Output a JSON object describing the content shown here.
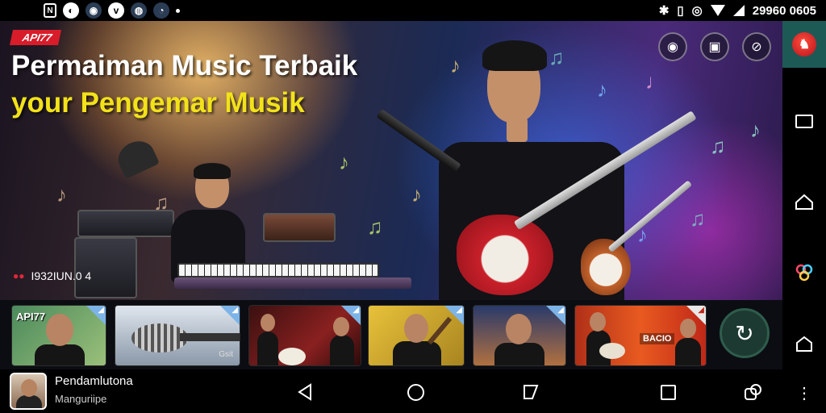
{
  "status_bar": {
    "left_icons": [
      "n-icon",
      "shield-icon",
      "avatar-icon",
      "vimeo-icon",
      "globe-icon",
      "sync-icon"
    ],
    "right_text": "29960 0605"
  },
  "hero": {
    "badge": "API77",
    "title_line1": "Permaiman Music Terbaik",
    "title_line2": "your Pengemar Musik",
    "counter": "I932IUN.0 4",
    "actions": [
      "cast-icon",
      "screenshot-icon",
      "mute-icon"
    ]
  },
  "thumbnails": [
    {
      "label": "API77",
      "caption": "",
      "promo": ""
    },
    {
      "label": "",
      "caption": "Gsit",
      "promo": ""
    },
    {
      "label": "",
      "caption": "",
      "promo": ""
    },
    {
      "label": "",
      "caption": "",
      "promo": ""
    },
    {
      "label": "",
      "caption": "",
      "promo": ""
    },
    {
      "label": "",
      "caption": "",
      "promo": "BACIO"
    }
  ],
  "fab": {
    "icon": "refresh-icon"
  },
  "profile": {
    "name": "Pendamlutona",
    "subtitle": "Manguriipe"
  },
  "navigation": [
    "back",
    "home",
    "recents-alt",
    "recents",
    "overlap"
  ],
  "right_rail": {
    "app_icon": "rooster-icon",
    "buttons": [
      "window-icon",
      "home-outline-icon",
      "color-wheel-icon",
      "house-icon",
      "more-icon"
    ]
  },
  "colors": {
    "badge_red": "#d91c2a",
    "title_yellow": "#f2e219",
    "rail_accent": "#1e5a55",
    "fab_green": "#1d3a32"
  }
}
